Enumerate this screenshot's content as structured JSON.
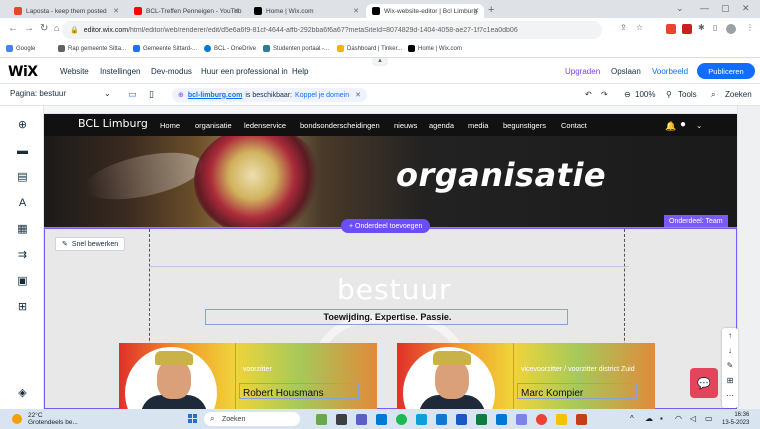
{
  "browser": {
    "tabs": [
      {
        "title": "Laposta - keep them posted",
        "color": "#e8452c"
      },
      {
        "title": "BCL-Treffen Penneigen - YouTub",
        "color": "#ff0000"
      },
      {
        "title": "Home | Wix.com",
        "color": "#000000"
      },
      {
        "title": "Wix-website-editor | Bcl Limburg",
        "color": "#000000"
      }
    ],
    "new_tab": "+",
    "url_prefix": "editor.wix.com",
    "url_rest": "/html/editor/web/renderer/edit/d5e6a6f9-81cf-4644-affb-292bba6f6a67?metaSiteId=8074829d-1404-4058-ae27-1f7c1ea0db06",
    "bookmarks": [
      "Google",
      "Rap gemeente Sitta...",
      "Gemeente Sittard-...",
      "BCL - OneDrive",
      "Studenten portaal -...",
      "Dashboard | Tinker...",
      "Home | Wix.com"
    ]
  },
  "wix": {
    "logo": "WiX",
    "menu": [
      "Website",
      "Instellingen",
      "Dev-modus",
      "Huur een professional in",
      "Help"
    ],
    "upgrade": "Upgraden",
    "save": "Opslaan",
    "preview": "Voorbeeld",
    "publish": "Publiceren",
    "page_label": "Pagina: bestuur",
    "domain_link": "bcl-limburg.com",
    "domain_text": "is beschikbaar:",
    "domain_action": "Koppel je domein",
    "zoom": "100%",
    "tools": "Tools",
    "search": "Zoeken"
  },
  "site": {
    "brand": "BCL Limburg",
    "nav": [
      "Home",
      "organisatie",
      "ledenservice",
      "bondsonderscheidingen",
      "nieuws",
      "agenda",
      "media",
      "begunstigers",
      "Contact"
    ],
    "hero_title": "organisatie",
    "add_section": "+ Onderdeel toevoegen",
    "section_tag": "Onderdeel: Team",
    "quick_edit": "Snel bewerken",
    "heading": "bestuur",
    "slogan": "Toewijding. Expertise. Passie.",
    "members": [
      {
        "role": "voorzitter",
        "name": "Robert Housmans"
      },
      {
        "role": "vicevoorzitter / voorzitter district Zuid",
        "name": "Marc Kompier"
      }
    ]
  },
  "taskbar": {
    "temp": "22°C",
    "weather": "Grotendeels be...",
    "search": "Zoeken",
    "time": "16:36",
    "date": "13-5-2023"
  }
}
